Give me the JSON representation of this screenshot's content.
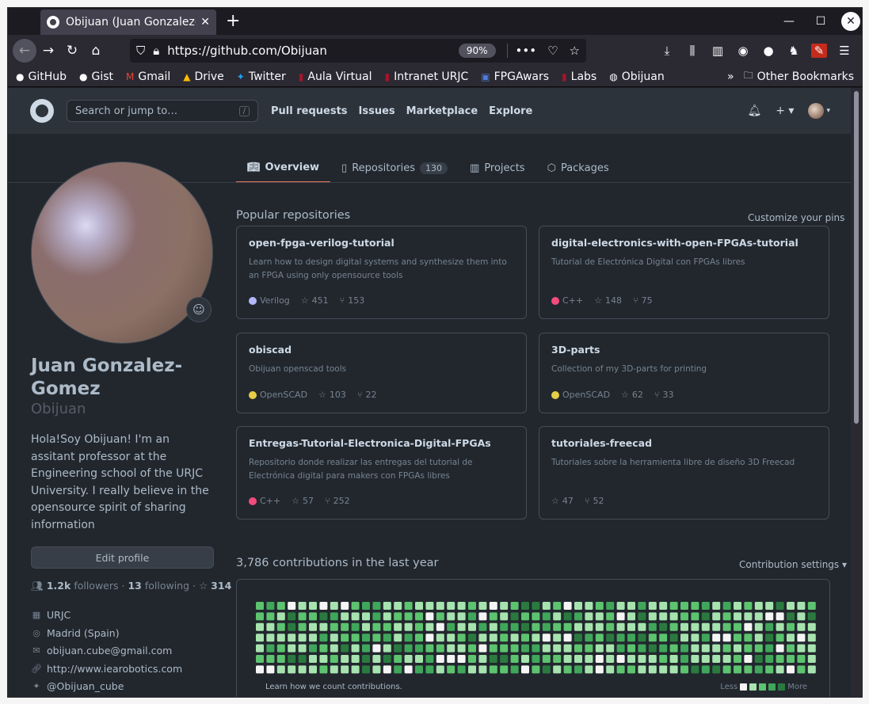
{
  "browser": {
    "tab_title": "Obijuan (Juan Gonzalez-Gomez)",
    "url": "https://github.com/Obijuan",
    "zoom": "90%",
    "bookmarks": [
      "GitHub",
      "Gist",
      "Gmail",
      "Drive",
      "Twitter",
      "Aula Virtual",
      "Intranet URJC",
      "FPGAwars",
      "Labs",
      "Obijuan"
    ],
    "other_bookmarks": "Other Bookmarks"
  },
  "header": {
    "search_placeholder": "Search or jump to…",
    "search_key": "/",
    "nav": [
      "Pull requests",
      "Issues",
      "Marketplace",
      "Explore"
    ]
  },
  "profile_tabs": {
    "overview": "Overview",
    "repositories": "Repositories",
    "repositories_count": "130",
    "projects": "Projects",
    "packages": "Packages"
  },
  "profile": {
    "name": "Juan Gonzalez-Gomez",
    "login": "Obijuan",
    "bio": "Hola!Soy Obijuan! I'm an assitant professor at the Engineering school of the URJC University. I really believe in the opensource spirit of sharing information",
    "edit_label": "Edit profile",
    "followers": "1.2k",
    "followers_label": "followers",
    "following": "13",
    "following_label": "following",
    "stars": "314",
    "company": "URJC",
    "location": "Madrid (Spain)",
    "email": "obijuan.cube@gmail.com",
    "website": "http://www.iearobotics.com",
    "twitter": "@Obijuan_cube"
  },
  "popular": {
    "heading": "Popular repositories",
    "customize": "Customize your pins",
    "repos": [
      {
        "name": "open-fpga-verilog-tutorial",
        "desc": "Learn how to design digital systems and synthesize them into an FPGA using only opensource tools",
        "lang": "Verilog",
        "lang_color": "#b2b7f8",
        "stars": "451",
        "forks": "153"
      },
      {
        "name": "digital-electronics-with-open-FPGAs-tutorial",
        "desc": "Tutorial de Electrónica Digital con FPGAs libres",
        "lang": "C++",
        "lang_color": "#f34b7d",
        "stars": "148",
        "forks": "75"
      },
      {
        "name": "obiscad",
        "desc": "Obijuan openscad tools",
        "lang": "OpenSCAD",
        "lang_color": "#e5cd45",
        "stars": "103",
        "forks": "22"
      },
      {
        "name": "3D-parts",
        "desc": "Collection of my 3D-parts for printing",
        "lang": "OpenSCAD",
        "lang_color": "#e5cd45",
        "stars": "62",
        "forks": "33"
      },
      {
        "name": "Entregas-Tutorial-Electronica-Digital-FPGAs",
        "desc": "Repositorio donde realizar las entregas del tutorial de Electrónica digital para makers con FPGAs libres",
        "lang": "C++",
        "lang_color": "#f34b7d",
        "stars": "57",
        "forks": "252"
      },
      {
        "name": "tutoriales-freecad",
        "desc": "Tutoriales sobre la herramienta libre de diseño 3D Freecad",
        "lang": "",
        "lang_color": "",
        "stars": "47",
        "forks": "52"
      }
    ]
  },
  "contributions": {
    "heading": "3,786 contributions in the last year",
    "settings": "Contribution settings ▾",
    "learn": "Learn how we count contributions.",
    "less": "Less",
    "more": "More"
  }
}
